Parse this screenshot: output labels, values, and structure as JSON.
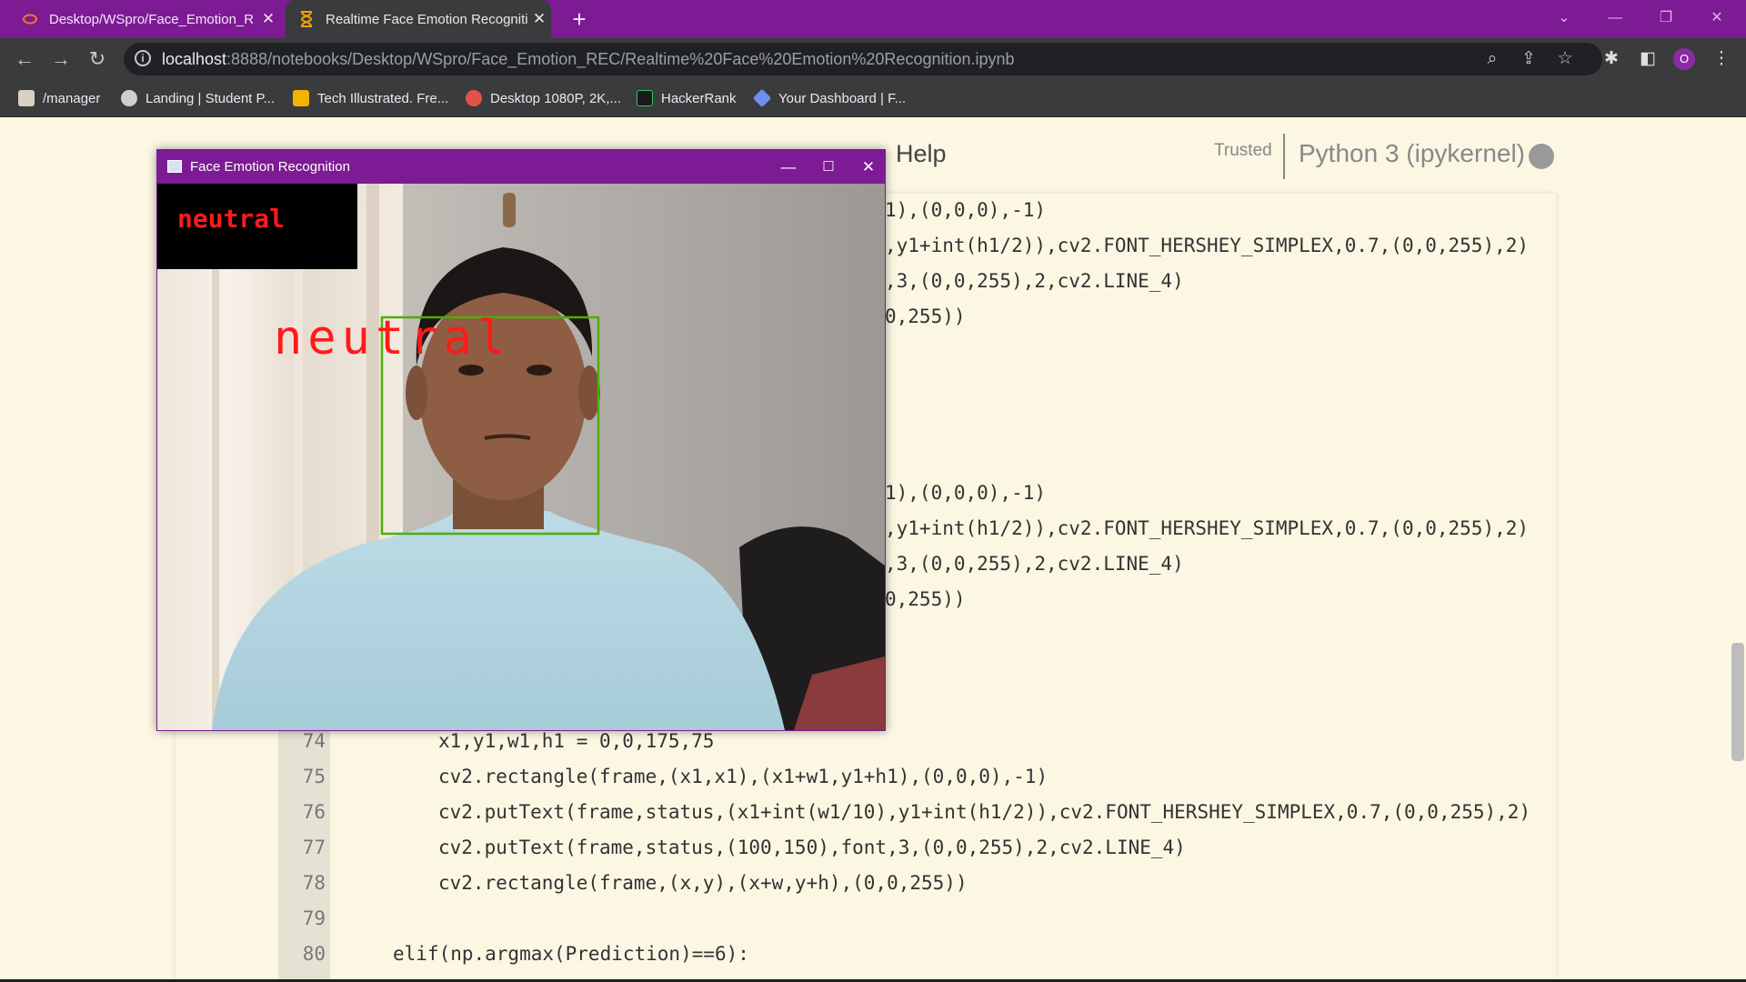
{
  "browser": {
    "tabs": [
      {
        "title": "Desktop/WSpro/Face_Emotion_R",
        "active": false
      },
      {
        "title": "Realtime Face Emotion Recogniti",
        "active": true
      }
    ],
    "url_host": "localhost",
    "url_path": ":8888/notebooks/Desktop/WSpro/Face_Emotion_REC/Realtime%20Face%20Emotion%20Recognition.ipynb",
    "profile_initial": "O",
    "bookmarks": [
      "/manager",
      "Landing | Student P...",
      "Tech Illustrated. Fre...",
      "Desktop 1080P, 2K,...",
      "HackerRank",
      "Your Dashboard | F..."
    ],
    "accent_color": "#7d1b94"
  },
  "notebook": {
    "menu_help": "Help",
    "trusted": "Trusted",
    "kernel": "Python 3 (ipykernel)",
    "partial_lines_top": [
      "1),(0,0,0),-1)",
      ",y1+int(h1/2)),cv2.FONT_HERSHEY_SIMPLEX,0.7,(0,0,255),2)",
      ",3,(0,0,255),2,cv2.LINE_4)",
      "0,255))"
    ],
    "partial_lines_mid": [
      "1),(0,0,0),-1)",
      ",y1+int(h1/2)),cv2.FONT_HERSHEY_SIMPLEX,0.7,(0,0,255),2)",
      ",3,(0,0,255),2,cv2.LINE_4)",
      "0,255))"
    ],
    "lines": [
      {
        "num": "74",
        "text": "x1,y1,w1,h1 = 0,0,175,75"
      },
      {
        "num": "75",
        "text": "cv2.rectangle(frame,(x1,x1),(x1+w1,y1+h1),(0,0,0),-1)"
      },
      {
        "num": "76",
        "text": "cv2.putText(frame,status,(x1+int(w1/10),y1+int(h1/2)),cv2.FONT_HERSHEY_SIMPLEX,0.7,(0,0,255),2)"
      },
      {
        "num": "77",
        "text": "cv2.putText(frame,status,(100,150),font,3,(0,0,255),2,cv2.LINE_4)"
      },
      {
        "num": "78",
        "text": "cv2.rectangle(frame,(x,y),(x+w,y+h),(0,0,255))"
      },
      {
        "num": "79",
        "text": ""
      },
      {
        "num": "80",
        "text": "elif(np.argmax(Prediction)==6):"
      }
    ]
  },
  "cv_window": {
    "title": "Face Emotion Recognition",
    "status_small": "neutral",
    "status_big": "neutral",
    "box_color": "#4caf00",
    "label_color": "#ff1a1a"
  }
}
